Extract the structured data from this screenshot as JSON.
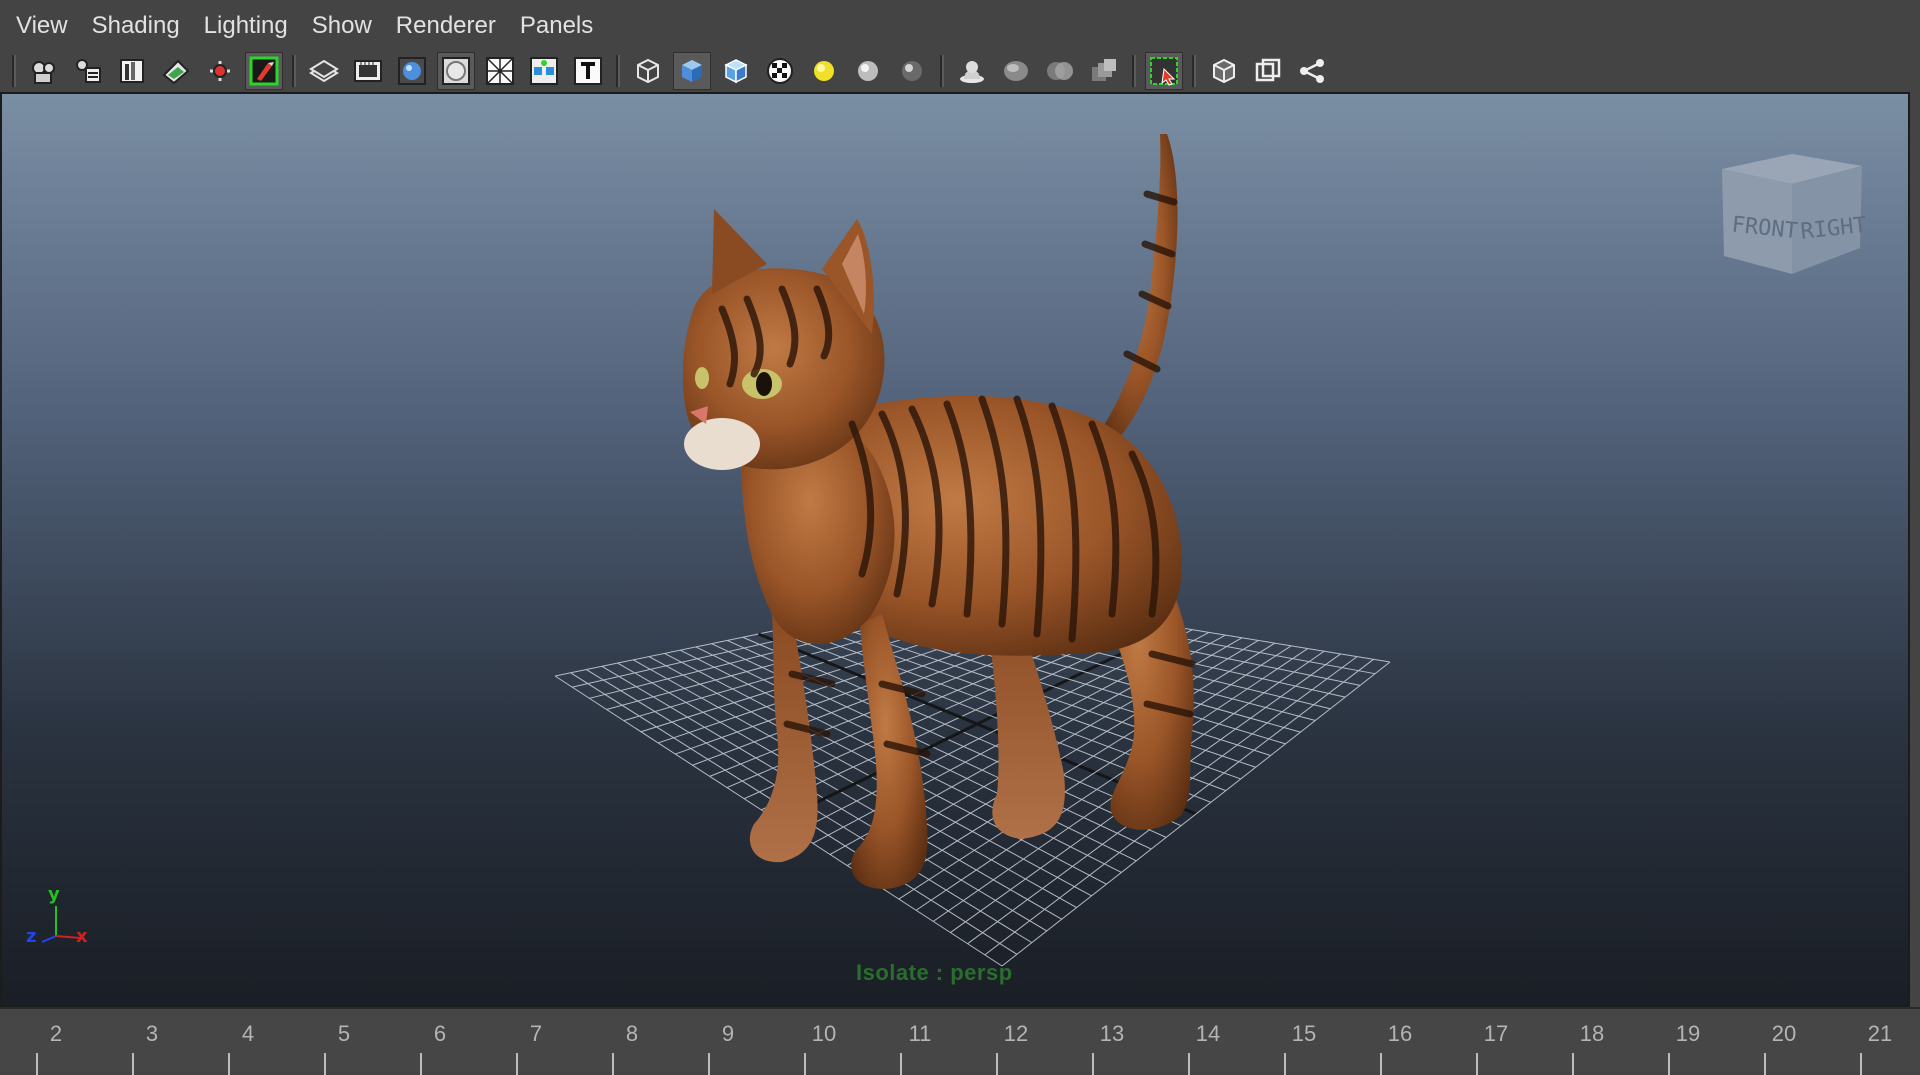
{
  "menus": [
    "View",
    "Shading",
    "Lighting",
    "Show",
    "Renderer",
    "Panels"
  ],
  "toolbar": {
    "groups": [
      [
        "camera-attributes-icon",
        "camera-tools-icon",
        "bookmarks-icon",
        "image-plane-icon",
        "pick-camera-icon",
        "film-gate-icon"
      ],
      [
        "wireframe-layers-icon",
        "resolution-gate-icon",
        "field-chart-icon",
        "safe-action-icon",
        "grid-icon",
        "xray-icon",
        "text-overlay-icon"
      ],
      [
        "wireframe-cube-icon",
        "smooth-shade-icon",
        "wireframe-on-shaded-icon",
        "textured-icon",
        "use-default-light-icon",
        "shadows-icon",
        "high-quality-icon"
      ],
      [
        "ambient-occlusion-icon",
        "motion-blur-icon",
        "anti-alias-icon",
        "depth-of-field-icon"
      ],
      [
        "isolate-select-icon"
      ],
      [
        "xray-joints-icon",
        "xray-active-icon",
        "share-icon"
      ]
    ],
    "pressed": [
      "film-gate-icon",
      "safe-action-icon",
      "smooth-shade-icon",
      "isolate-select-icon"
    ]
  },
  "viewport": {
    "view_cube": {
      "front_label": "FRONT",
      "right_label": "RIGHT"
    },
    "axis": {
      "x": "x",
      "y": "y",
      "z": "z"
    },
    "isolate_label": "Isolate : persp",
    "colors": {
      "gradient_top": "#7a8ea4",
      "gradient_bottom": "#1a1e25",
      "cat_fur": "#a0582a",
      "cat_stripes": "#2a1408",
      "isolate_text": "#2a6e2e"
    }
  },
  "timeline": {
    "ticks": [
      "2",
      "3",
      "4",
      "5",
      "6",
      "7",
      "8",
      "9",
      "10",
      "11",
      "12",
      "13",
      "14",
      "15",
      "16",
      "17",
      "18",
      "19",
      "20",
      "21"
    ]
  }
}
